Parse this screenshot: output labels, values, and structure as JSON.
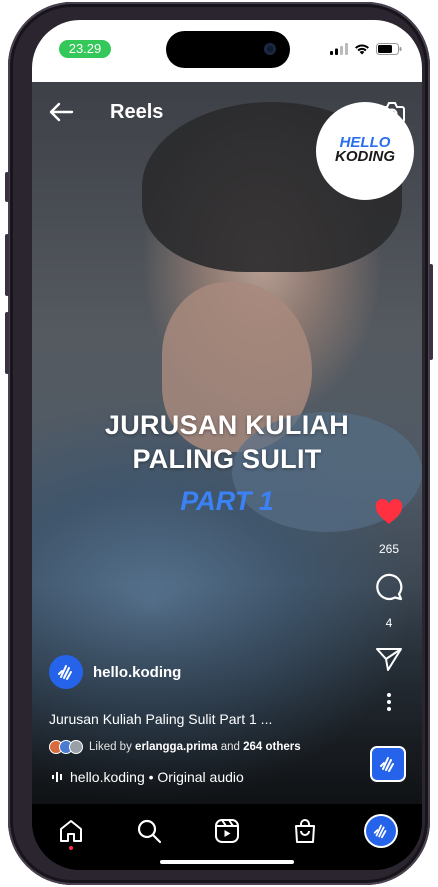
{
  "status_bar": {
    "time": "23.29",
    "signal_icon": "cellular-signal-icon",
    "wifi_icon": "wifi-icon",
    "battery_icon": "battery-icon",
    "time_pill_color": "#34c759"
  },
  "header": {
    "back_icon": "arrow-left-icon",
    "title": "Reels",
    "camera_icon": "camera-icon"
  },
  "video": {
    "logo_line1": "HELLO",
    "logo_line2": "KODING",
    "headline_line1": "JURUSAN KULIAH",
    "headline_line2": "PALING SULIT",
    "headline_part": "PART 1",
    "accent_color": "#3b82f6"
  },
  "actions": {
    "like_icon": "heart-filled-icon",
    "like_count": "265",
    "like_color": "#ff3040",
    "comment_icon": "comment-bubble-icon",
    "comment_count": "4",
    "share_icon": "paper-plane-icon",
    "more_icon": "more-vertical-icon"
  },
  "post": {
    "author": "hello.koding",
    "caption": "Jurusan Kuliah Paling Sulit Part 1 ...",
    "liked_prefix": "Liked by",
    "liked_user": "erlangga.prima",
    "liked_and": "and",
    "liked_others": "264 others",
    "audio_icon": "audio-wave-icon",
    "audio_text": "hello.koding • Original audio"
  },
  "bottom_nav": {
    "items": [
      {
        "icon": "home-icon",
        "active": true
      },
      {
        "icon": "search-icon"
      },
      {
        "icon": "reels-icon"
      },
      {
        "icon": "shopping-bag-icon"
      },
      {
        "icon": "profile-avatar-icon"
      }
    ]
  }
}
